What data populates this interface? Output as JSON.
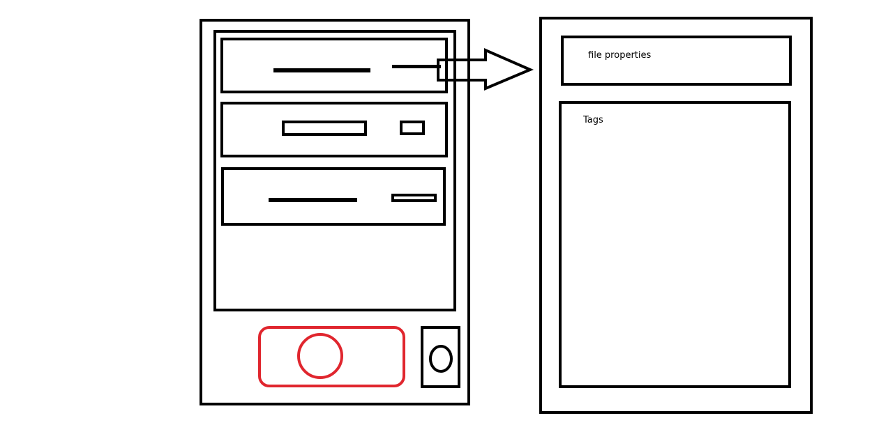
{
  "colors": {
    "outline": "#000000",
    "record_button": "#e0262e",
    "background": "#ffffff"
  },
  "detail_panel": {
    "properties_label": "file properties",
    "tags_label": "Tags"
  },
  "icons": {
    "record": "record-icon",
    "camera_switch": "camera-switch-icon",
    "arrow": "arrow-right-icon"
  }
}
